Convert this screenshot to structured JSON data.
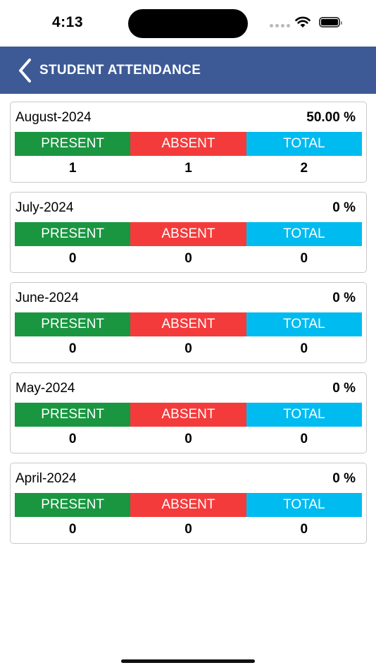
{
  "status_bar": {
    "time": "4:13"
  },
  "header": {
    "title": "STUDENT ATTENDANCE",
    "background": "#3d5a96"
  },
  "labels": {
    "present": "PRESENT",
    "absent": "ABSENT",
    "total": "TOTAL"
  },
  "colors": {
    "present": "#1a9641",
    "absent": "#f43b3b",
    "total": "#00bbf0"
  },
  "months": [
    {
      "month": "August-2024",
      "percent": "50.00 %",
      "present": "1",
      "absent": "1",
      "total": "2"
    },
    {
      "month": "July-2024",
      "percent": "0 %",
      "present": "0",
      "absent": "0",
      "total": "0"
    },
    {
      "month": "June-2024",
      "percent": "0 %",
      "present": "0",
      "absent": "0",
      "total": "0"
    },
    {
      "month": "May-2024",
      "percent": "0 %",
      "present": "0",
      "absent": "0",
      "total": "0"
    },
    {
      "month": "April-2024",
      "percent": "0 %",
      "present": "0",
      "absent": "0",
      "total": "0"
    }
  ]
}
